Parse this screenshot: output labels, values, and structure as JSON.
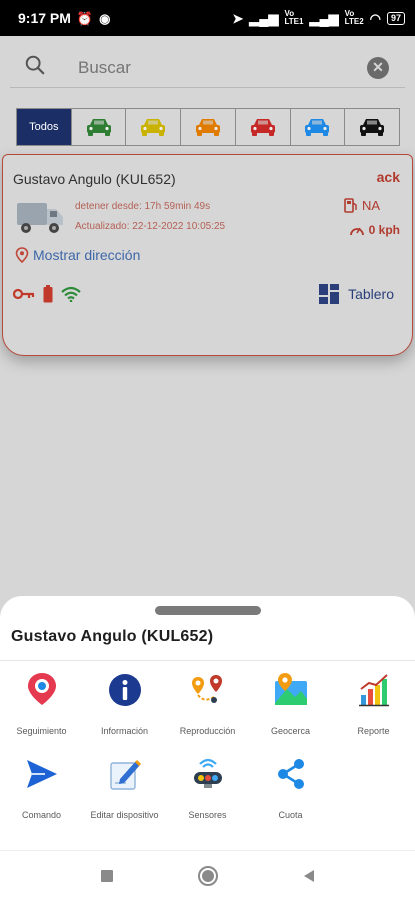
{
  "status_bar": {
    "time": "9:17 PM",
    "net1": "Vo\nLTE1",
    "net2": "Vo\nLTE2",
    "net3": "Vo\nWiFi",
    "battery": "97"
  },
  "search": {
    "placeholder": "Buscar"
  },
  "filters": {
    "all_label": "Todos",
    "colors": [
      "#2e7d32",
      "#c9b300",
      "#e07b00",
      "#c62828",
      "#1e88e5",
      "#111111"
    ]
  },
  "vehicle": {
    "name": "Gustavo Angulo (KUL652)",
    "status": "ack",
    "stopped_since": "detener desde: 17h 59min 49s",
    "updated": "Actualizado: 22-12-2022 10:05:25",
    "fuel": "NA",
    "speed": "0 kph",
    "address_link": "Mostrar dirección",
    "dashboard_label": "Tablero"
  },
  "sheet": {
    "title": "Gustavo Angulo (KUL652)",
    "actions": [
      {
        "label": "Seguimiento",
        "icon": "tracking-pin-icon"
      },
      {
        "label": "Información",
        "icon": "info-icon"
      },
      {
        "label": "Reproducción",
        "icon": "playback-route-icon"
      },
      {
        "label": "Geocerca",
        "icon": "geofence-map-icon"
      },
      {
        "label": "Reporte",
        "icon": "report-chart-icon"
      },
      {
        "label": "Comando",
        "icon": "send-command-icon"
      },
      {
        "label": "Editar dispositivo",
        "icon": "edit-device-icon"
      },
      {
        "label": "Sensores",
        "icon": "sensors-icon"
      },
      {
        "label": "Cuota",
        "icon": "share-icon"
      }
    ]
  },
  "colors": {
    "accent_navy": "#1b2f66",
    "alert_red": "#b03a2e",
    "link_blue": "#3e67a8"
  }
}
